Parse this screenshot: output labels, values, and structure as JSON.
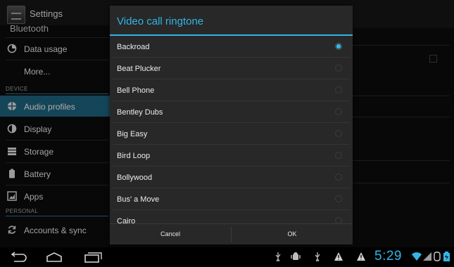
{
  "app": {
    "title": "Settings"
  },
  "sidebar": {
    "cut_item": "Bluetooth",
    "items_top": [
      {
        "label": "Data usage",
        "icon": "data-usage-icon"
      },
      {
        "label": "More...",
        "icon": ""
      }
    ],
    "section_device": "DEVICE",
    "items_device": [
      {
        "label": "Audio profiles",
        "icon": "audio-profiles-icon",
        "active": true
      },
      {
        "label": "Display",
        "icon": "display-icon"
      },
      {
        "label": "Storage",
        "icon": "storage-icon"
      },
      {
        "label": "Battery",
        "icon": "battery-icon"
      },
      {
        "label": "Apps",
        "icon": "apps-icon"
      }
    ],
    "section_personal": "PERSONAL",
    "items_personal": [
      {
        "label": "Accounts & sync",
        "icon": "sync-icon"
      }
    ]
  },
  "dialog": {
    "title": "Video call ringtone",
    "ringtones": [
      {
        "name": "Backroad",
        "selected": true
      },
      {
        "name": "Beat Plucker",
        "selected": false
      },
      {
        "name": "Bell Phone",
        "selected": false
      },
      {
        "name": "Bentley Dubs",
        "selected": false
      },
      {
        "name": "Big Easy",
        "selected": false
      },
      {
        "name": "Bird Loop",
        "selected": false
      },
      {
        "name": "Bollywood",
        "selected": false
      },
      {
        "name": "Bus' a Move",
        "selected": false
      },
      {
        "name": "Cairo",
        "selected": false
      }
    ],
    "cancel_label": "Cancel",
    "ok_label": "OK"
  },
  "system_bar": {
    "clock": "5:29",
    "nav_icons": [
      "back-icon",
      "home-icon",
      "recent-apps-icon"
    ],
    "status_icons": [
      "usb-icon",
      "android-debug-icon",
      "usb-icon",
      "warning-icon",
      "warning-icon",
      "wifi-icon",
      "signal-icon",
      "battery-icon"
    ]
  },
  "colors": {
    "accent": "#33b5e5",
    "active_item": "#1d5c76",
    "dialog_bg": "#282828"
  }
}
